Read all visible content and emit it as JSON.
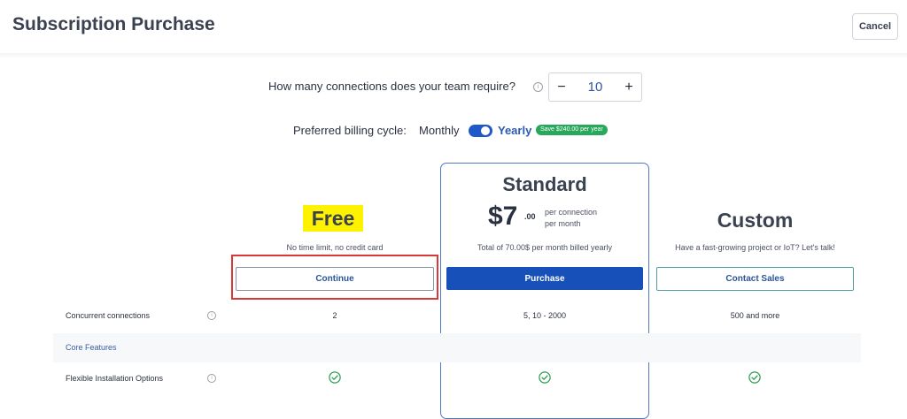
{
  "header": {
    "title": "Subscription Purchase",
    "cancel_label": "Cancel"
  },
  "connections": {
    "question": "How many connections does your team require?",
    "info_icon": "info-icon",
    "minus_label": "−",
    "value": "10",
    "plus_label": "+"
  },
  "billing": {
    "label": "Preferred billing cycle:",
    "monthly_label": "Monthly",
    "yearly_label": "Yearly",
    "toggle_state": "yearly",
    "save_badge": "Save $240.00 per year",
    "badge_color": "#28a85a"
  },
  "plans": {
    "free": {
      "name": "Free",
      "subtitle": "No time limit, no credit card",
      "button_label": "Continue",
      "highlight_color": "#fff200",
      "outline_color": "#d83a3a"
    },
    "standard": {
      "name": "Standard",
      "price_main": "$7",
      "price_cents": ".00",
      "price_unit_line1": "per connection",
      "price_unit_line2": "per month",
      "subtitle": "Total of 70.00$ per month billed yearly",
      "button_label": "Purchase",
      "button_color": "#1750b8"
    },
    "custom": {
      "name": "Custom",
      "subtitle": "Have a fast-growing project or IoT? Let's talk!",
      "button_label": "Contact Sales"
    }
  },
  "features": {
    "concurrent": {
      "label": "Concurrent connections",
      "free": "2",
      "standard": "5, 10 - 2000",
      "custom": "500 and more"
    },
    "core_section": "Core Features",
    "flexible": {
      "label": "Flexible Installation Options",
      "free": "check-icon",
      "standard": "check-icon",
      "custom": "check-icon"
    }
  }
}
